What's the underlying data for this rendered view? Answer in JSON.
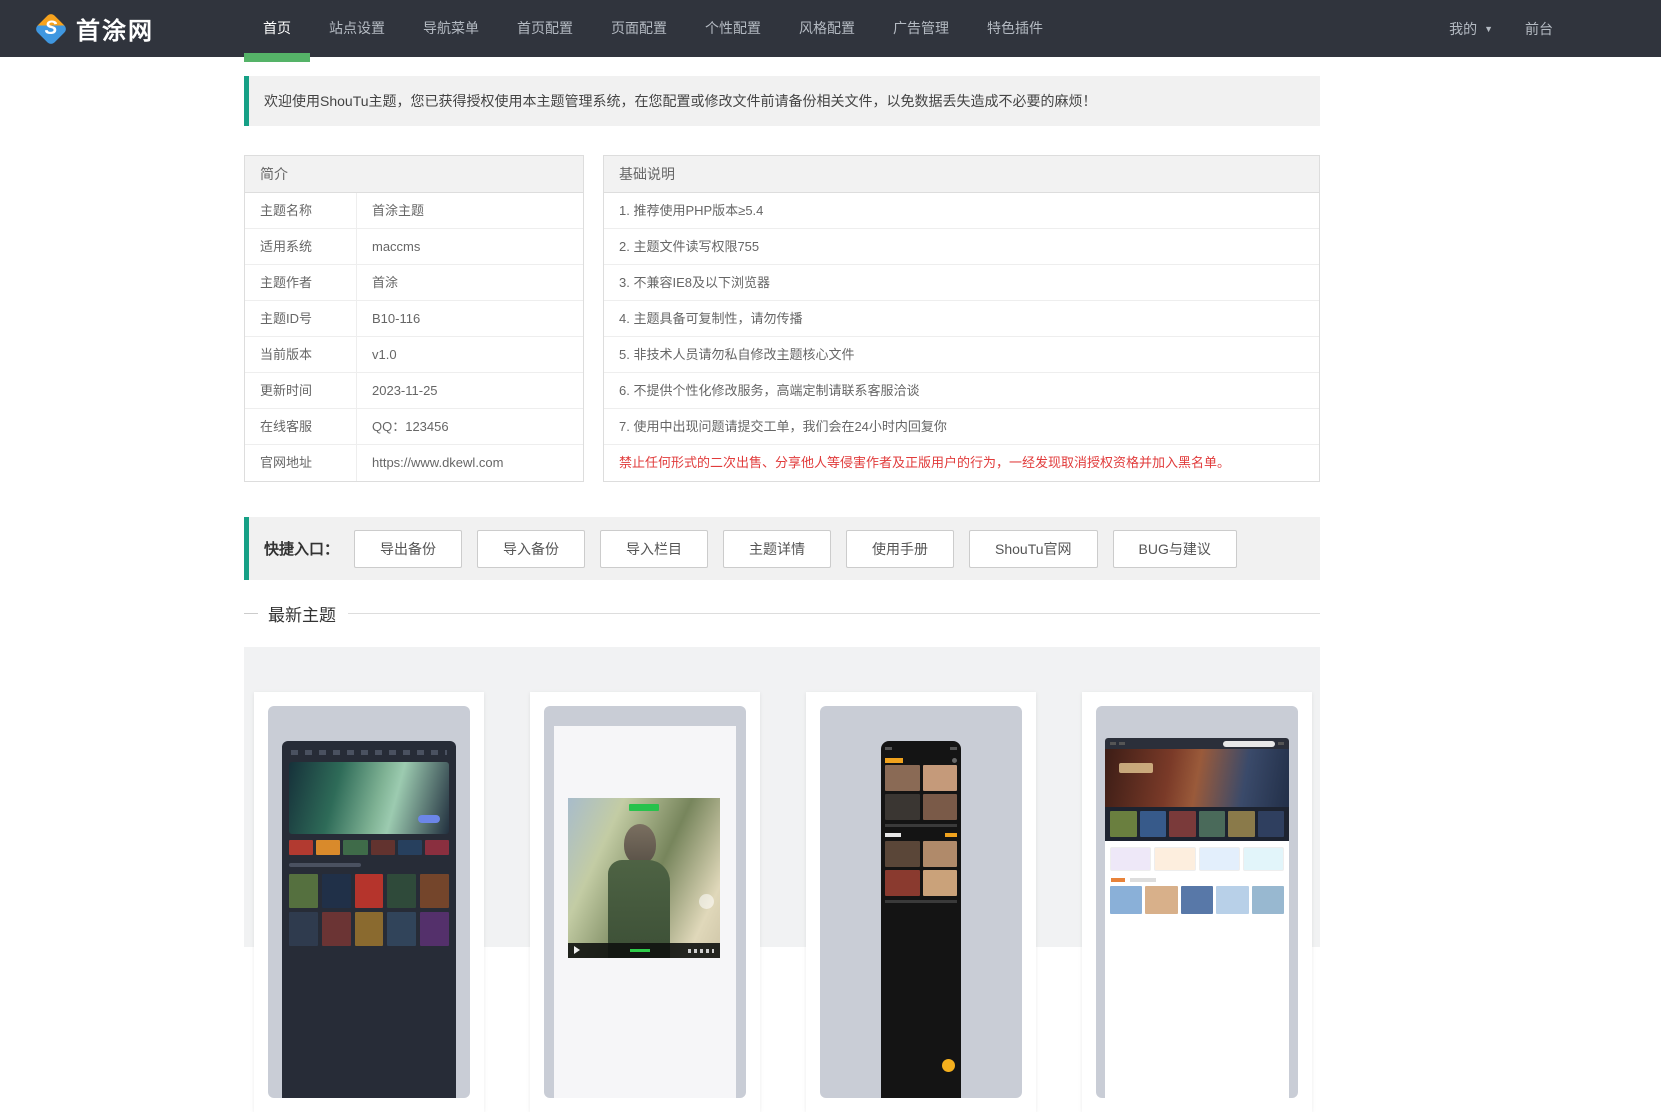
{
  "navbar": {
    "logo_text": "首涂网",
    "items": [
      "首页",
      "站点设置",
      "导航菜单",
      "首页配置",
      "页面配置",
      "个性配置",
      "风格配置",
      "广告管理",
      "特色插件"
    ],
    "active_item": "首页",
    "my_label": "我的",
    "frontend_label": "前台"
  },
  "welcome": {
    "text": "欢迎使用ShouTu主题，您已获得授权使用本主题管理系统，在您配置或修改文件前请备份相关文件，以免数据丢失造成不必要的麻烦！"
  },
  "intro_panel": {
    "title": "简介",
    "rows": [
      {
        "label": "主题名称",
        "value": "首涂主题"
      },
      {
        "label": "适用系统",
        "value": "maccms"
      },
      {
        "label": "主题作者",
        "value": "首涂"
      },
      {
        "label": "主题ID号",
        "value": "B10-116"
      },
      {
        "label": "当前版本",
        "value": "v1.0"
      },
      {
        "label": "更新时间",
        "value": "2023-11-25"
      },
      {
        "label": "在线客服",
        "value": "QQ：123456"
      },
      {
        "label": "官网地址",
        "value": "https://www.dkewl.com"
      }
    ]
  },
  "notes_panel": {
    "title": "基础说明",
    "items": [
      "1. 推荐使用PHP版本≥5.4",
      "2. 主题文件读写权限755",
      "3. 不兼容IE8及以下浏览器",
      "4. 主题具备可复制性，请勿传播",
      "5. 非技术人员请勿私自修改主题核心文件",
      "6. 不提供个性化修改服务，高端定制请联系客服洽谈",
      "7. 使用中出现问题请提交工单，我们会在24小时内回复你"
    ],
    "warning": "禁止任何形式的二次出售、分享他人等侵害作者及正版用户的行为，一经发现取消授权资格并加入黑名单。"
  },
  "quick_entry": {
    "label": "快捷入口：",
    "buttons": [
      "导出备份",
      "导入备份",
      "导入栏目",
      "主题详情",
      "使用手册",
      "ShouTu官网",
      "BUG与建议"
    ]
  },
  "latest_themes": {
    "title": "最新主题",
    "cards": [
      {
        "name": "dark-movie-site-theme",
        "strip": [
          "#b23a30",
          "#d98a2b",
          "#3f6b49",
          "#62332f",
          "#27405e",
          "#8a2f3f"
        ],
        "grid": [
          "#55703f",
          "#203048",
          "#b5342c",
          "#2f4a3a",
          "#74452b",
          "#2f3b4e",
          "#6b3434",
          "#8a6a2f",
          "#31445a",
          "#54306b"
        ]
      },
      {
        "name": "video-player-theme"
      },
      {
        "name": "mobile-dark-theme",
        "grid1": [
          "#8a6a55",
          "#c59a7a",
          "#3a3632",
          "#7a5a48"
        ],
        "grid2": [
          "#5a4638",
          "#b08a6a",
          "#8a3a2f",
          "#caa27a"
        ]
      },
      {
        "name": "light-movie-site-theme",
        "posters": [
          "#6a7f3f",
          "#375a8a",
          "#7a3a3a",
          "#4a6a5a",
          "#8a7a4a",
          "#2f3f5f"
        ],
        "features": [
          "#eee8f8",
          "#fdeede",
          "#e3effc",
          "#e2f5fa"
        ],
        "bottom_row": [
          "#8ab0d8",
          "#d8b08a",
          "#5878a8",
          "#b8d0e8",
          "#98b8d0"
        ]
      }
    ]
  },
  "colors": {
    "navbar_bg": "#30343d",
    "accent_green": "#55b368",
    "section_teal": "#16a086",
    "warning_red": "#e13b3b",
    "thumb_grey": "#c9cdd6",
    "logo_blue": "#3f97e0",
    "logo_orange": "#f6a21d"
  }
}
